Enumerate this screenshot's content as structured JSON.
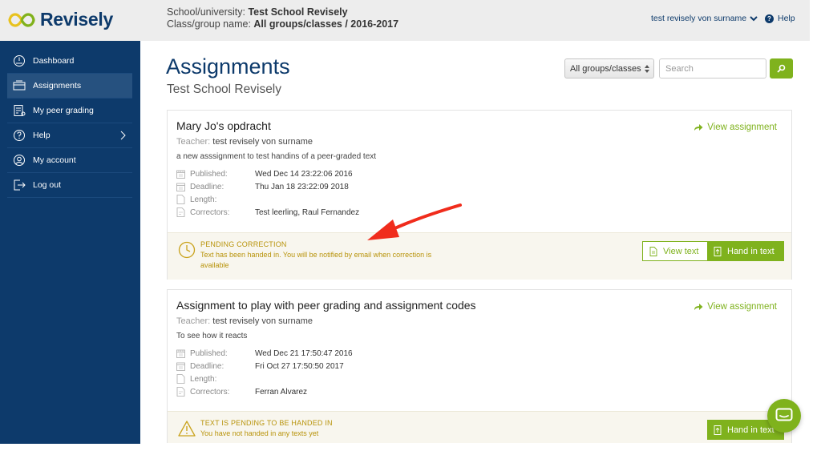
{
  "header": {
    "logo_text": "Revisely",
    "school_label": "School/university:",
    "school_value": "Test School Revisely",
    "class_label": "Class/group name:",
    "class_value": "All groups/classes / 2016-2017",
    "user_name": "test revisely von surname",
    "help_label": "Help"
  },
  "sidebar": {
    "items": [
      {
        "label": "Dashboard",
        "icon": "dashboard-icon"
      },
      {
        "label": "Assignments",
        "icon": "assignments-icon",
        "active": true
      },
      {
        "label": "My peer grading",
        "icon": "peer-grading-icon"
      },
      {
        "label": "Help",
        "icon": "help-icon"
      },
      {
        "label": "My account",
        "icon": "account-icon"
      },
      {
        "label": "Log out",
        "icon": "logout-icon"
      }
    ]
  },
  "main": {
    "title": "Assignments",
    "subtitle": "Test School Revisely",
    "group_select": "All groups/classes",
    "search_placeholder": "Search"
  },
  "assignments": [
    {
      "title": "Mary Jo's opdracht",
      "teacher_label": "Teacher:",
      "teacher": "test revisely von surname",
      "description": "a new asssignment to test handins of a peer-graded text",
      "view_label": "View assignment",
      "meta": [
        {
          "label": "Published:",
          "value": "Wed Dec 14 23:22:06 2016"
        },
        {
          "label": "Deadline:",
          "value": "Thu Jan 18 23:22:09 2018"
        },
        {
          "label": "Length:",
          "value": ""
        },
        {
          "label": "Correctors:",
          "value": "Test leerling, Raul Fernandez"
        }
      ],
      "status_title": "Pending correction",
      "status_text": "Text has been handed in. You will be notified by email when correction is available",
      "view_text_label": "View text",
      "hand_in_label": "Hand in text"
    },
    {
      "title": "Assignment to play with peer grading and assignment codes",
      "teacher_label": "Teacher:",
      "teacher": "test revisely von surname",
      "description": "To see how it reacts",
      "view_label": "View assignment",
      "meta": [
        {
          "label": "Published:",
          "value": "Wed Dec 21 17:50:47 2016"
        },
        {
          "label": "Deadline:",
          "value": "Fri Oct 27 17:50:50 2017"
        },
        {
          "label": "Length:",
          "value": ""
        },
        {
          "label": "Correctors:",
          "value": "Ferran Alvarez"
        }
      ],
      "status_title": "Text is pending to be handed in",
      "status_text": "You have not handed in any texts yet",
      "hand_in_label": "Hand in text"
    }
  ],
  "colors": {
    "brand_navy": "#0d3a6b",
    "accent_green": "#7fb21d",
    "status_gold": "#b8930a",
    "annotation_red": "#f02c1c"
  }
}
